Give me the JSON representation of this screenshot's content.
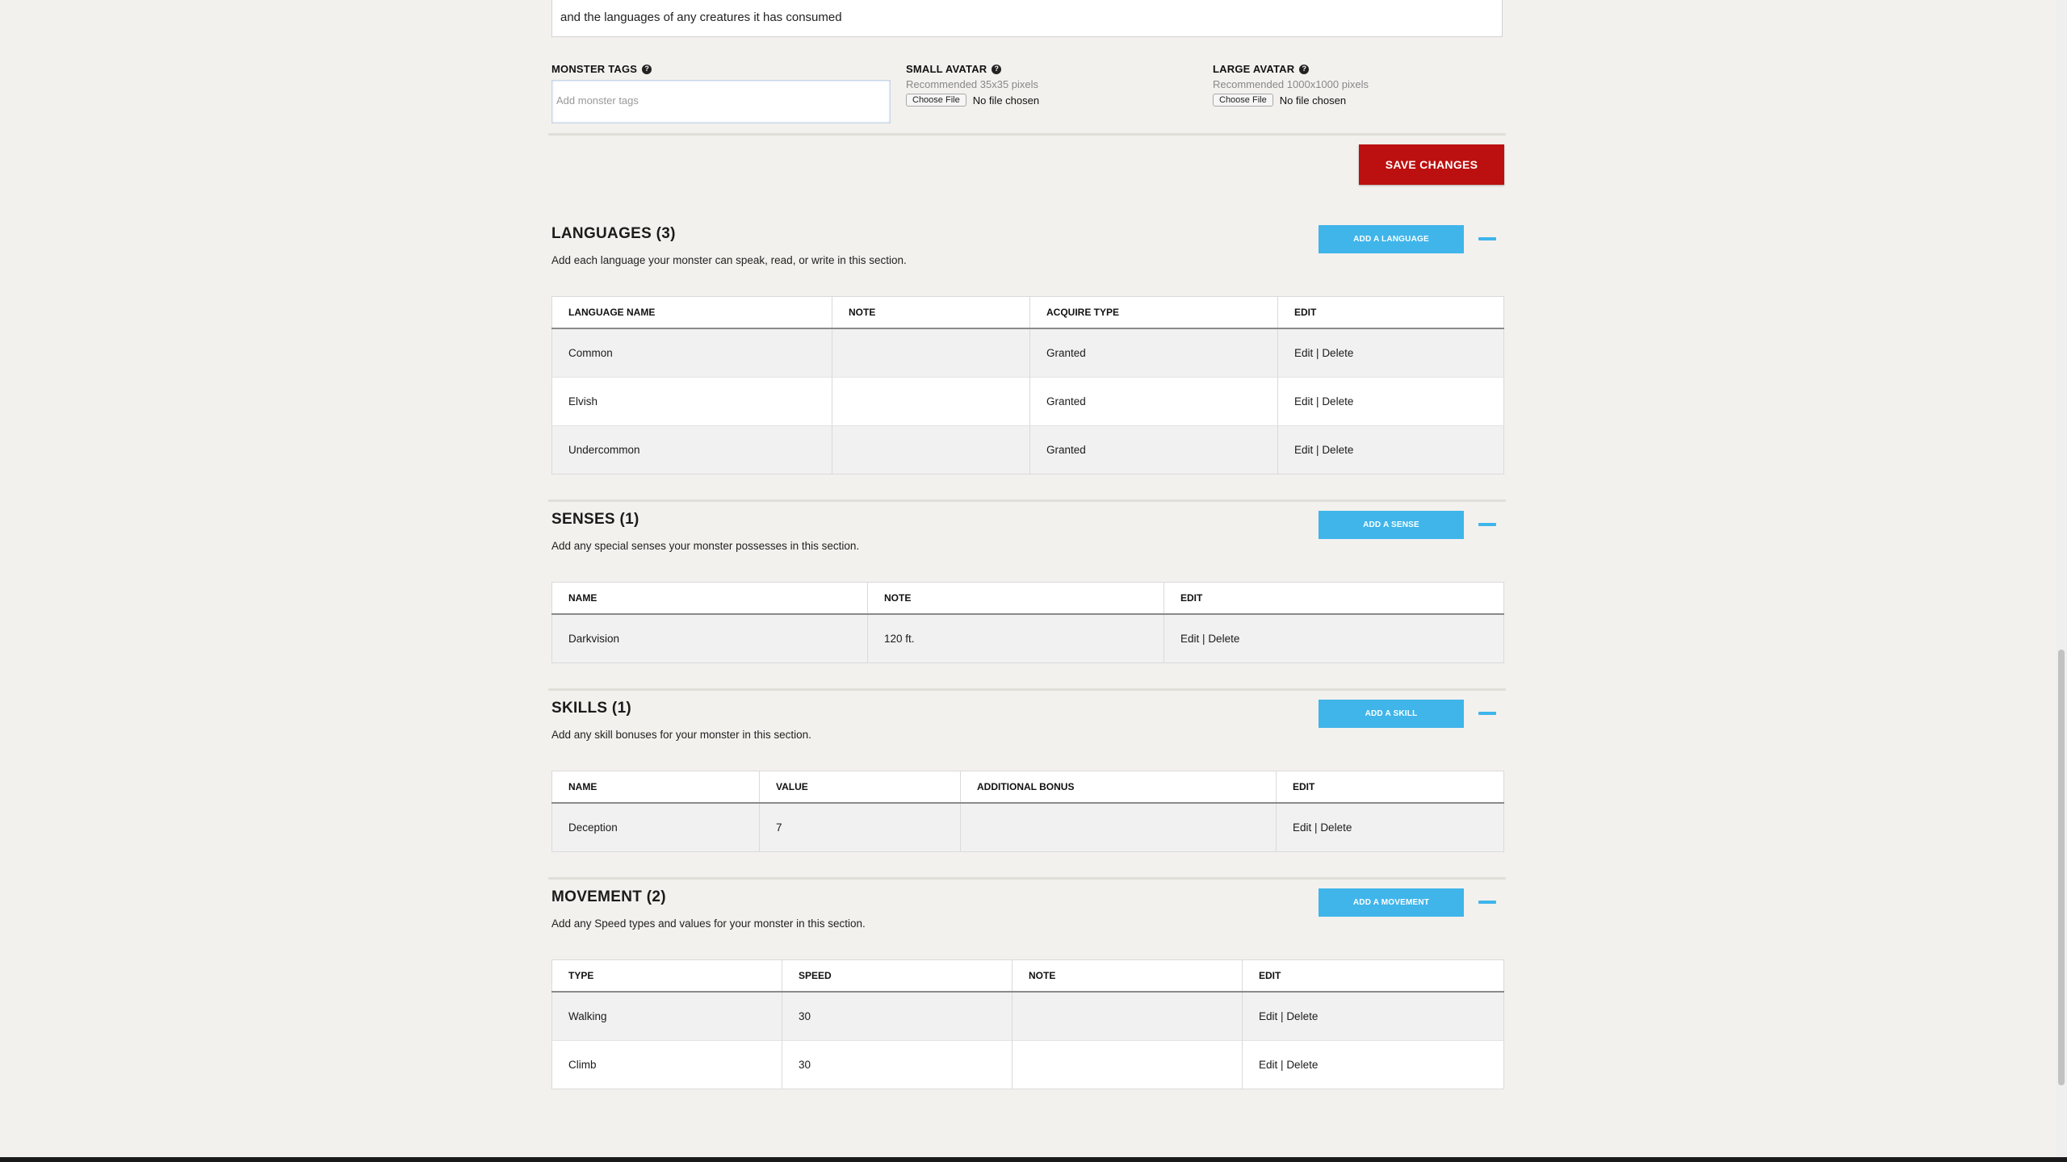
{
  "description_text": "and the languages of any creatures it has consumed",
  "monster_tags": {
    "label": "MONSTER TAGS",
    "placeholder": "Add monster tags"
  },
  "small_avatar": {
    "label": "SMALL AVATAR",
    "note": "Recommended 35x35 pixels",
    "button": "Choose File",
    "status": "No file chosen"
  },
  "large_avatar": {
    "label": "LARGE AVATAR",
    "note": "Recommended 1000x1000 pixels",
    "button": "Choose File",
    "status": "No file chosen"
  },
  "save_label": "SAVE CHANGES",
  "help_glyph": "?",
  "edit_label": "Edit",
  "delete_label": "Delete",
  "sep": "|",
  "languages": {
    "title": "LANGUAGES (3)",
    "desc": "Add each language your monster can speak, read, or write in this section.",
    "add_label": "ADD A LANGUAGE",
    "headers": [
      "LANGUAGE NAME",
      "NOTE",
      "ACQUIRE TYPE",
      "EDIT"
    ],
    "rows": [
      {
        "name": "Common",
        "note": "",
        "acquire": "Granted"
      },
      {
        "name": "Elvish",
        "note": "",
        "acquire": "Granted"
      },
      {
        "name": "Undercommon",
        "note": "",
        "acquire": "Granted"
      }
    ]
  },
  "senses": {
    "title": "SENSES (1)",
    "desc": "Add any special senses your monster possesses in this section.",
    "add_label": "ADD A SENSE",
    "headers": [
      "NAME",
      "NOTE",
      "EDIT"
    ],
    "rows": [
      {
        "name": "Darkvision",
        "note": "120 ft."
      }
    ]
  },
  "skills": {
    "title": "SKILLS (1)",
    "desc": "Add any skill bonuses for your monster in this section.",
    "add_label": "ADD A SKILL",
    "headers": [
      "NAME",
      "VALUE",
      "ADDITIONAL BONUS",
      "EDIT"
    ],
    "rows": [
      {
        "name": "Deception",
        "value": "7",
        "bonus": ""
      }
    ]
  },
  "movement": {
    "title": "MOVEMENT (2)",
    "desc": "Add any Speed types and values for your monster in this section.",
    "add_label": "ADD A MOVEMENT",
    "headers": [
      "TYPE",
      "SPEED",
      "NOTE",
      "EDIT"
    ],
    "rows": [
      {
        "type": "Walking",
        "speed": "30",
        "note": ""
      },
      {
        "type": "Climb",
        "speed": "30",
        "note": ""
      }
    ]
  },
  "colors": {
    "save": "#bc0f0f",
    "accent": "#3fb5ea"
  }
}
